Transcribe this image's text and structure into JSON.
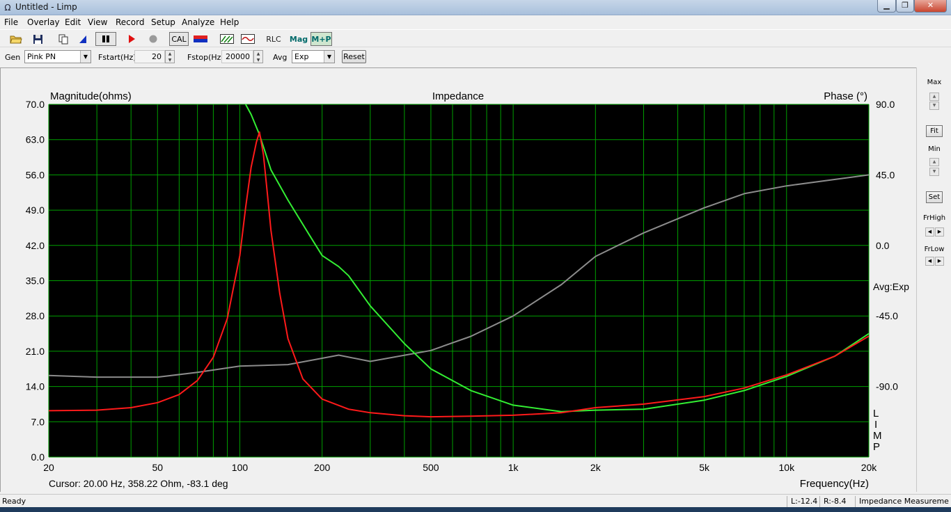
{
  "window": {
    "title": "Untitled - Limp",
    "app_icon": "Ω"
  },
  "menu": [
    "File",
    "Overlay",
    "Edit",
    "View",
    "Record",
    "Setup",
    "Analyze",
    "Help"
  ],
  "toolbar": {
    "cal_label": "CAL",
    "rlc_label": "RLC",
    "mag_label": "Mag",
    "mp_label": "M+P"
  },
  "genbar": {
    "gen_label": "Gen",
    "gen_value": "Pink PN",
    "fstart_label": "Fstart(Hz)",
    "fstart_value": "20",
    "fstop_label": "Fstop(Hz)",
    "fstop_value": "20000",
    "avg_label": "Avg",
    "avg_value": "Exp",
    "reset_label": "Reset"
  },
  "right_panel": {
    "max_label": "Max",
    "fit_label": "Fit",
    "min_label": "Min",
    "set_label": "Set",
    "frhigh_label": "FrHigh",
    "frlow_label": "FrLow"
  },
  "chart_annotations": {
    "cursor_readout": "Cursor: 20.00 Hz, 358.22 Ohm, -83.1 deg",
    "avg_mode": "Avg:Exp",
    "limp_mark": [
      "L",
      "I",
      "M",
      "P"
    ]
  },
  "status": {
    "ready": "Ready",
    "left": "L:-12.4",
    "right": "R:-8.4",
    "mode": "Impedance Measuremen"
  },
  "colors": {
    "plot_bg": "#000000",
    "grid": "#00a000",
    "magnitude": "#ff1a1a",
    "overlay": "#33ee33",
    "phase": "#8c8c8c"
  },
  "chart_data": {
    "type": "line",
    "title": "Impedance",
    "ylabel": "Magnitude(ohms)",
    "y2label": "Phase (°)",
    "xlabel": "Frequency(Hz)",
    "xscale": "log",
    "xlim": [
      20,
      20000
    ],
    "ylim": [
      0,
      70
    ],
    "y2lim": [
      -135,
      90
    ],
    "xticks": [
      20,
      50,
      100,
      200,
      500,
      1000,
      2000,
      5000,
      10000,
      20000
    ],
    "xtick_labels": [
      "20",
      "50",
      "100",
      "200",
      "500",
      "1k",
      "2k",
      "5k",
      "10k",
      "20k"
    ],
    "yticks": [
      0,
      7,
      14,
      21,
      28,
      35,
      42,
      49,
      56,
      63,
      70
    ],
    "ytick_labels": [
      "0.0",
      "7.0",
      "14.0",
      "21.0",
      "28.0",
      "35.0",
      "42.0",
      "49.0",
      "56.0",
      "63.0",
      "70.0"
    ],
    "y2ticks": [
      90,
      45,
      0,
      -45,
      -90
    ],
    "y2tick_labels": [
      "90.0",
      "45.0",
      "0.0",
      "-45.0",
      "-90.0"
    ],
    "grid": true,
    "series": [
      {
        "axis": "left",
        "color": "#ff1a1a",
        "x": [
          20,
          30,
          40,
          50,
          60,
          70,
          80,
          90,
          100,
          105,
          110,
          115,
          118,
          122,
          126,
          130,
          140,
          150,
          170,
          200,
          250,
          300,
          400,
          500,
          700,
          1000,
          1500,
          2000,
          3000,
          5000,
          7000,
          10000,
          15000,
          20000
        ],
        "y": [
          9.2,
          9.3,
          9.8,
          10.8,
          12.4,
          15.2,
          19.8,
          27.5,
          40.0,
          49.5,
          57.5,
          62.5,
          64.5,
          60.0,
          52.5,
          45.0,
          32.5,
          23.5,
          15.5,
          11.5,
          9.5,
          8.8,
          8.2,
          8.0,
          8.1,
          8.3,
          8.8,
          9.8,
          10.5,
          12.0,
          13.7,
          16.3,
          20.0,
          24.0
        ]
      },
      {
        "axis": "left",
        "color": "#33ee33",
        "x": [
          105,
          110,
          118,
          130,
          150,
          180,
          200,
          230,
          250,
          300,
          400,
          500,
          700,
          1000,
          1500,
          2000,
          3000,
          5000,
          7000,
          10000,
          15000,
          20000
        ],
        "y": [
          70.0,
          68.0,
          64.0,
          57.0,
          51.0,
          44.0,
          40.0,
          37.8,
          36.0,
          30.0,
          22.5,
          17.5,
          13.2,
          10.3,
          9.0,
          9.3,
          9.5,
          11.3,
          13.2,
          16.0,
          20.0,
          24.5
        ]
      },
      {
        "axis": "right",
        "color": "#8c8c8c",
        "x": [
          20,
          30,
          50,
          70,
          100,
          150,
          200,
          230,
          300,
          500,
          700,
          1000,
          1500,
          2000,
          3000,
          5000,
          7000,
          10000,
          20000
        ],
        "y": [
          -83,
          -84,
          -84,
          -81,
          -77,
          -76,
          -72,
          -70,
          -74,
          -67,
          -58,
          -45,
          -25,
          -7,
          8,
          24,
          33,
          38,
          45
        ]
      }
    ]
  }
}
